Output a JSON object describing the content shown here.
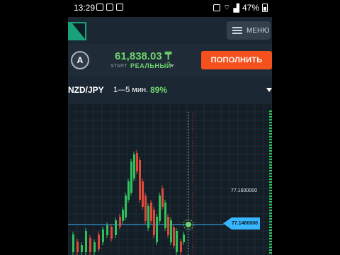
{
  "status_bar": {
    "time": "13:29",
    "battery": "47%"
  },
  "nav": {
    "menu_label": "МЕНЮ"
  },
  "account": {
    "avatar_letter": "A",
    "balance": "61,838.03 ₸",
    "start_label": "START",
    "account_type": "РЕАЛЬНЫЙ",
    "deposit_label": "ПОПОЛНИТЬ"
  },
  "asset": {
    "name": "NZD/JPY",
    "duration": "1—5 мин.",
    "payout": "89%"
  },
  "chart": {
    "price_level_label": "77.1600000",
    "current_price": "77.1460000",
    "colors": {
      "up": "#2fc25b",
      "down": "#e0483a",
      "current_line": "#38b6ff",
      "accent": "#6fd36a"
    }
  }
}
